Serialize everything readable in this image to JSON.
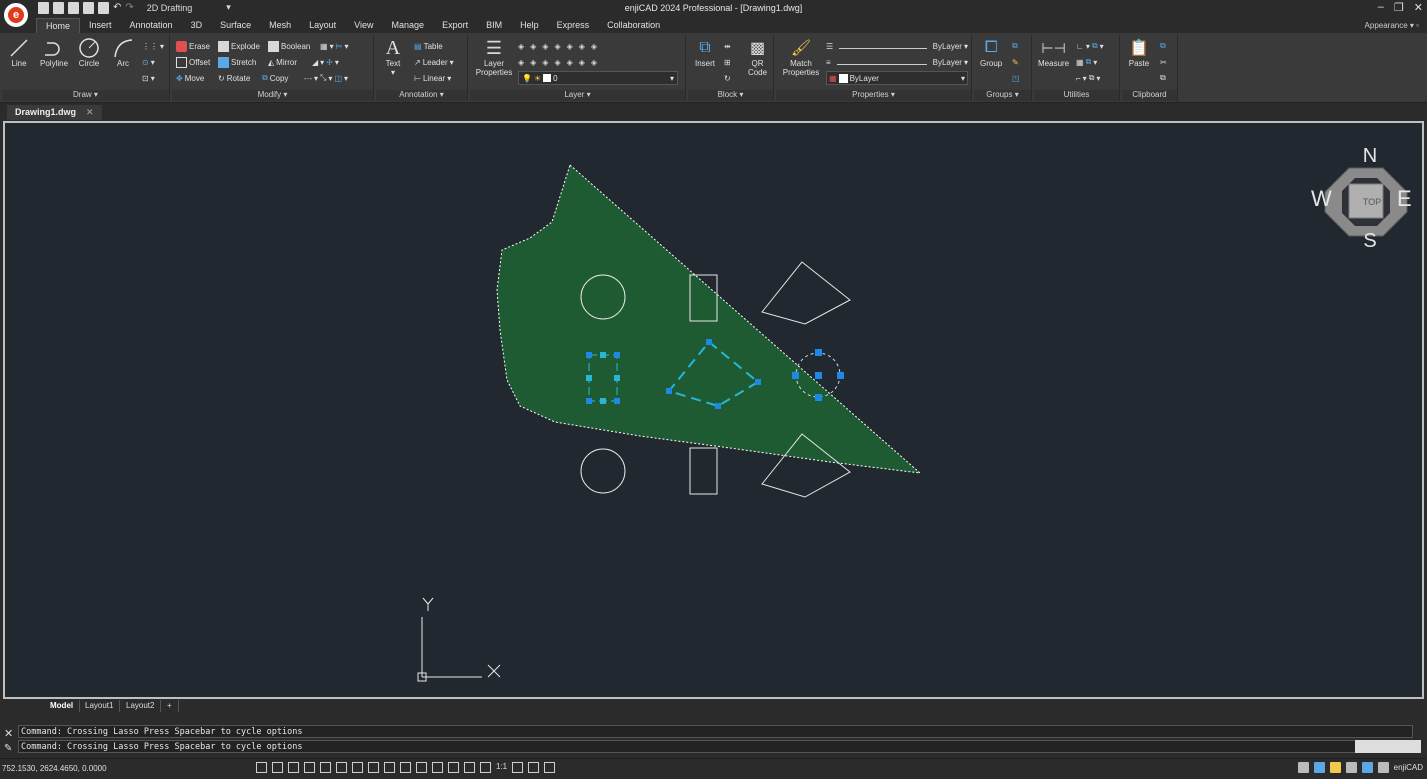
{
  "window": {
    "title": "enjiCAD 2024 Professional - [Drawing1.dwg]",
    "workspace": "2D Drafting",
    "appearance": "Appearance"
  },
  "tabs": [
    "Home",
    "Insert",
    "Annotation",
    "3D",
    "Surface",
    "Mesh",
    "Layout",
    "View",
    "Manage",
    "Export",
    "BIM",
    "Help",
    "Express",
    "Collaboration"
  ],
  "ribbon": {
    "draw": {
      "title": "Draw",
      "line": "Line",
      "polyline": "Polyline",
      "circle": "Circle",
      "arc": "Arc"
    },
    "modify": {
      "title": "Modify",
      "erase": "Erase",
      "explode": "Explode",
      "boolean": "Boolean",
      "offset": "Offset",
      "stretch": "Stretch",
      "mirror": "Mirror",
      "move": "Move",
      "rotate": "Rotate",
      "copy": "Copy"
    },
    "annotation": {
      "title": "Annotation",
      "text": "Text",
      "table": "Table",
      "leader": "Leader",
      "linear": "Linear"
    },
    "layer": {
      "title": "Layer",
      "properties": "Layer Properties",
      "current": "0"
    },
    "block": {
      "title": "Block",
      "insert": "Insert",
      "qr": "QR Code"
    },
    "properties": {
      "title": "Properties",
      "match": "Match Properties",
      "linetype": "ByLayer",
      "lineweight": "ByLayer",
      "color": "ByLayer"
    },
    "groups": {
      "title": "Groups",
      "group": "Group"
    },
    "utilities": {
      "title": "Utilities",
      "measure": "Measure"
    },
    "clipboard": {
      "title": "Clipboard",
      "paste": "Paste"
    }
  },
  "document": {
    "tab": "Drawing1.dwg"
  },
  "viewcube": {
    "n": "N",
    "s": "S",
    "e": "E",
    "w": "W",
    "top": "TOP"
  },
  "ucs": {
    "x": "X",
    "y": "Y"
  },
  "layouts": [
    "Model",
    "Layout1",
    "Layout2",
    "+"
  ],
  "command": {
    "line1": "Command: Crossing Lasso  Press Spacebar to cycle options",
    "line2": "Command: Crossing Lasso  Press Spacebar to cycle options"
  },
  "status": {
    "coords": "752.1530, 2624.4650, 0.0000",
    "scale": "1:1",
    "brand": "enjiCAD"
  },
  "colors": {
    "canvas": "#212830",
    "lasso": "#1e5a32",
    "grip": "#1e88e5",
    "selected": "#29b6d6"
  }
}
